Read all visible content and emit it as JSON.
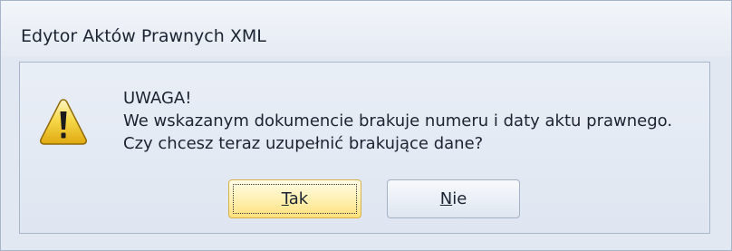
{
  "window": {
    "title": "Edytor Aktów Prawnych XML"
  },
  "dialog": {
    "icon": "warning-icon",
    "heading": "UWAGA!",
    "line1": "We wskazanym dokumencie brakuje numeru i daty aktu prawnego.",
    "line2": "Czy chcesz teraz uzupełnić brakujące dane?"
  },
  "buttons": {
    "yes": {
      "mnemonic": "T",
      "rest": "ak"
    },
    "no": {
      "mnemonic": "N",
      "rest": "ie"
    }
  },
  "colors": {
    "window_border": "#a6b4c8",
    "dialog_background": "#e2e8f2",
    "default_button": "#fff0b0",
    "warning_yellow": "#f4d03a"
  }
}
